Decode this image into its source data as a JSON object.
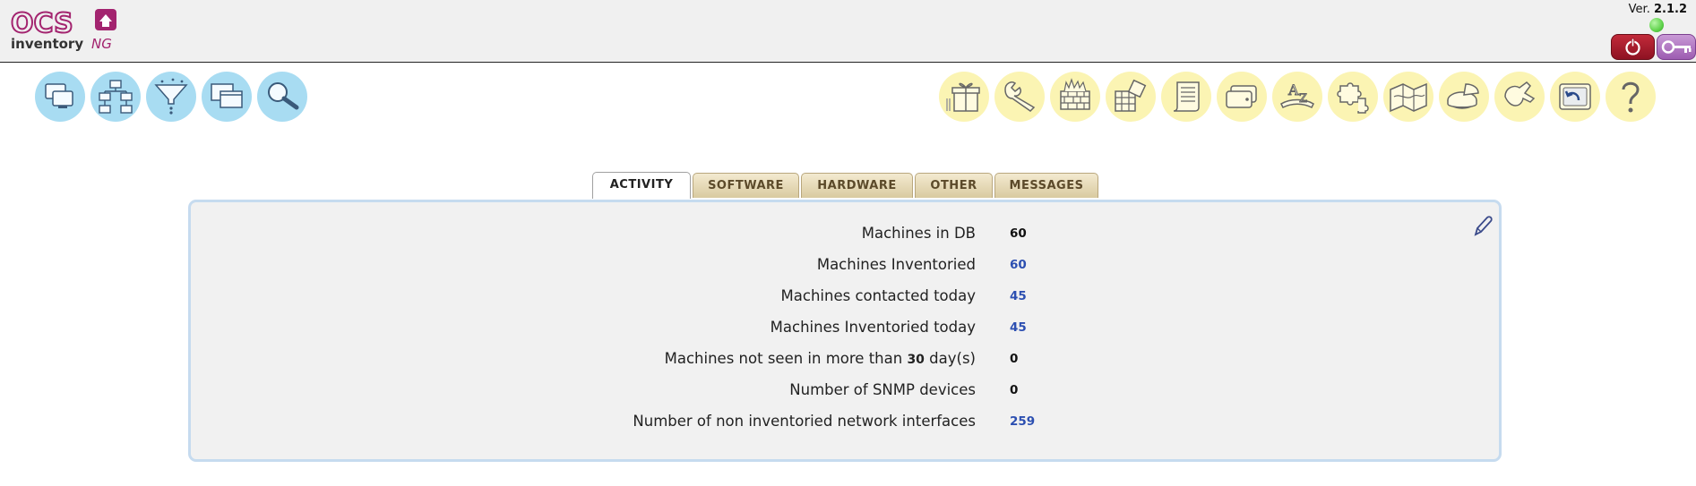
{
  "header": {
    "logo": {
      "text_top": "OCS",
      "text_bottom": "inventory",
      "suffix": "NG"
    },
    "version_prefix": "Ver.",
    "version_number": "2.1.2",
    "status_icon": "green-dot-icon",
    "logout_icon": "power-icon",
    "password_icon": "key-icon"
  },
  "toolbar_left": [
    {
      "icon": "computers-icon"
    },
    {
      "icon": "network-icon"
    },
    {
      "icon": "filter-icon"
    },
    {
      "icon": "windows-icon"
    },
    {
      "icon": "search-icon"
    }
  ],
  "toolbar_right": [
    {
      "icon": "gift-icon"
    },
    {
      "icon": "wrench-icon"
    },
    {
      "icon": "firewall-icon"
    },
    {
      "icon": "spreadsheet-icon"
    },
    {
      "icon": "scroll-icon"
    },
    {
      "icon": "cards-icon"
    },
    {
      "icon": "dictionary-icon"
    },
    {
      "icon": "puzzle-icon"
    },
    {
      "icon": "map-icon"
    },
    {
      "icon": "pie-chart-icon"
    },
    {
      "icon": "plugin-icon"
    },
    {
      "icon": "return-icon"
    },
    {
      "icon": "help-icon"
    }
  ],
  "tabs": [
    {
      "label": "ACTIVITY",
      "active": true
    },
    {
      "label": "SOFTWARE",
      "active": false
    },
    {
      "label": "HARDWARE",
      "active": false
    },
    {
      "label": "OTHER",
      "active": false
    },
    {
      "label": "MESSAGES",
      "active": false
    }
  ],
  "activity": {
    "rows": [
      {
        "label": "Machines in DB",
        "value": "60",
        "link": false
      },
      {
        "label": "Machines Inventoried",
        "value": "60",
        "link": true
      },
      {
        "label": "Machines contacted today",
        "value": "45",
        "link": true
      },
      {
        "label": "Machines Inventoried today",
        "value": "45",
        "link": true
      },
      {
        "label_prefix": "Machines not seen in more than",
        "label_days": "30",
        "label_suffix": "day(s)",
        "value": "0",
        "link": false
      },
      {
        "label": "Number of SNMP devices",
        "value": "0",
        "link": false
      },
      {
        "label": "Number of non inventoried network interfaces",
        "value": "259",
        "link": true
      }
    ],
    "edit_icon": "pencil-icon"
  },
  "colors": {
    "tool_blue": "#a8dcf2",
    "tool_yellow": "#fbf4b3",
    "link_blue": "#2c4fb1",
    "panel_border": "#c6dbef"
  }
}
